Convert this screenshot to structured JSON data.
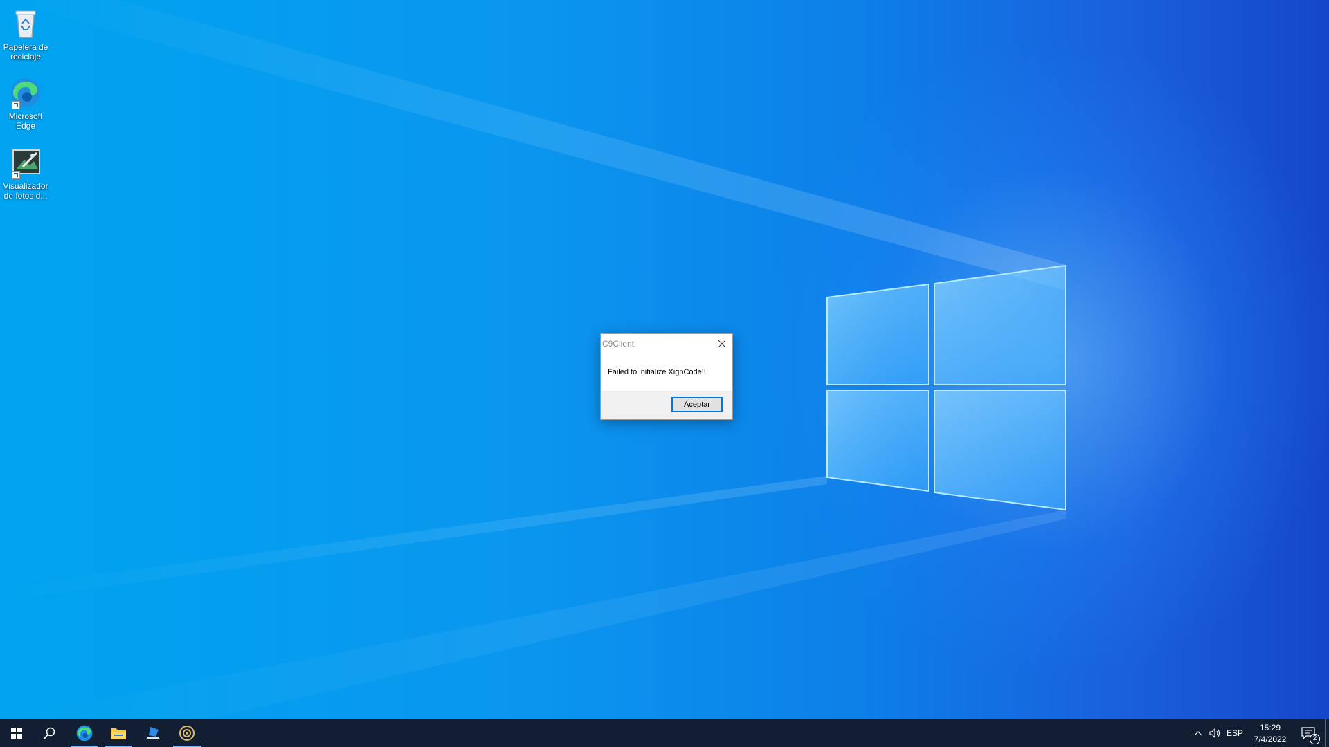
{
  "desktop": {
    "icons": [
      {
        "label_line1": "Papelera de",
        "label_line2": "reciclaje",
        "icon": "recycle-bin-icon"
      },
      {
        "label_line1": "Microsoft",
        "label_line2": "Edge",
        "icon": "edge-icon"
      },
      {
        "label_line1": "Visualizador",
        "label_line2": "de fotos d...",
        "icon": "photo-viewer-icon"
      }
    ]
  },
  "dialog": {
    "title": "C9Client",
    "message": "Failed to initialize XignCode!!",
    "ok_label": "Aceptar"
  },
  "taskbar": {
    "apps": [
      {
        "icon": "windows-start-icon"
      },
      {
        "icon": "search-icon"
      },
      {
        "icon": "edge-icon",
        "active": true
      },
      {
        "icon": "file-explorer-icon",
        "active": true
      },
      {
        "icon": "app-launcher-icon"
      },
      {
        "icon": "c9-game-icon",
        "active": true
      }
    ],
    "tray": {
      "language": "ESP",
      "time": "15:29",
      "date": "7/4/2022",
      "notification_count": "2"
    }
  },
  "colors": {
    "desktop_blue": "#0a96ef",
    "taskbar": "#121f33",
    "accent": "#0078d7"
  }
}
